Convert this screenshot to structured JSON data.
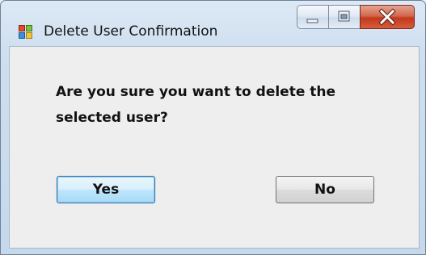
{
  "window": {
    "title": "Delete User Confirmation",
    "app_icon": "windows-form-icon",
    "caption_buttons": {
      "minimize_icon": "minimize-icon",
      "maximize_icon": "maximize-icon",
      "close_icon": "close-icon"
    }
  },
  "dialog": {
    "message": "Are you sure you want to delete the selected user?",
    "yes_label": "Yes",
    "no_label": "No"
  },
  "colors": {
    "client_background": "#eeeeee",
    "frame_accent": "#c5d8ec",
    "close_button": "#c3391c",
    "default_button_border": "#3c7fb1"
  }
}
